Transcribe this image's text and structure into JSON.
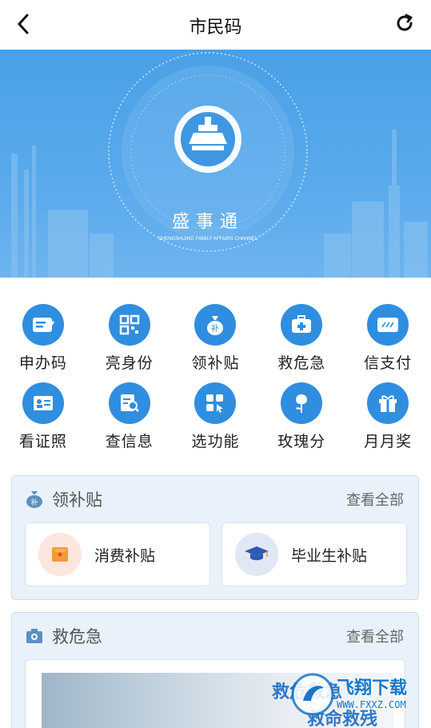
{
  "header": {
    "title": "市民码",
    "back_icon": "chevron-left-icon",
    "refresh_icon": "refresh-icon"
  },
  "banner": {
    "logo_text": "盛事通",
    "logo_subtext": "SHENGSHIJING FAMILY AFFAIRS CHANNEL"
  },
  "grid": {
    "row1": [
      {
        "label": "申办码",
        "icon": "id-card-edit-icon"
      },
      {
        "label": "亮身份",
        "icon": "qr-code-icon"
      },
      {
        "label": "领补贴",
        "icon": "money-bag-icon"
      },
      {
        "label": "救危急",
        "icon": "first-aid-kit-icon"
      },
      {
        "label": "信支付",
        "icon": "credit-card-icon"
      }
    ],
    "row2": [
      {
        "label": "看证照",
        "icon": "certificate-icon"
      },
      {
        "label": "查信息",
        "icon": "search-document-icon"
      },
      {
        "label": "选功能",
        "icon": "select-grid-icon"
      },
      {
        "label": "玫瑰分",
        "icon": "rose-icon"
      },
      {
        "label": "月月奖",
        "icon": "gift-icon"
      }
    ]
  },
  "subsidy": {
    "title": "领补贴",
    "more": "查看全部",
    "items": [
      {
        "label": "消费补贴",
        "icon": "red-envelope-icon"
      },
      {
        "label": "毕业生补贴",
        "icon": "graduation-cap-icon"
      }
    ]
  },
  "emergency": {
    "title": "救危急",
    "more": "查看全部",
    "photo_line1": "救危救急",
    "photo_line2": "救命救残"
  },
  "watermark": {
    "text": "飞翔下载",
    "url": "WWW.FXXZ.COM"
  },
  "colors": {
    "accent": "#2f8ee0",
    "banner": "#5aaaec",
    "card_bg": "#e9f2fb"
  }
}
